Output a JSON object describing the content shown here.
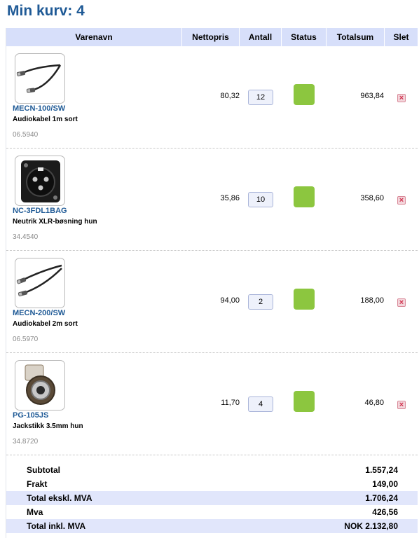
{
  "cart": {
    "title": "Min kurv: 4"
  },
  "columns": {
    "name": "Varenavn",
    "net_price": "Nettopris",
    "qty": "Antall",
    "status": "Status",
    "total": "Totalsum",
    "delete": "Slet"
  },
  "items": [
    {
      "code": "MECN-100/SW",
      "name": "Audiokabel 1m sort",
      "sku": "06.5940",
      "price": "80,32",
      "qty": "12",
      "total": "963,84",
      "status_color": "#8cc63f",
      "image_icon": "black-xlr-cable-icon"
    },
    {
      "code": "NC-3FDL1BAG",
      "name": "Neutrik XLR-bøsning hun",
      "sku": "34.4540",
      "price": "35,86",
      "qty": "10",
      "total": "358,60",
      "status_color": "#8cc63f",
      "image_icon": "xlr-socket-icon"
    },
    {
      "code": "MECN-200/SW",
      "name": "Audiokabel 2m sort",
      "sku": "06.5970",
      "price": "94,00",
      "qty": "2",
      "total": "188,00",
      "status_color": "#8cc63f",
      "image_icon": "black-xlr-cable-icon"
    },
    {
      "code": "PG-105JS",
      "name": "Jackstikk 3.5mm hun",
      "sku": "34.8720",
      "price": "11,70",
      "qty": "4",
      "total": "46,80",
      "status_color": "#8cc63f",
      "image_icon": "jack-socket-icon"
    }
  ],
  "summary": {
    "subtotal_label": "Subtotal",
    "subtotal": "1.557,24",
    "freight_label": "Frakt",
    "freight": "149,00",
    "excl_label": "Total ekskl. MVA",
    "excl": "1.706,24",
    "vat_label": "Mva",
    "vat": "426,56",
    "incl_label": "Total inkl. MVA",
    "incl": "NOK 2.132,80"
  },
  "colors": {
    "title": "#1f5a96",
    "header_bg": "#d7dffa",
    "status_ok": "#8cc63f",
    "delete": "#d0344f"
  }
}
